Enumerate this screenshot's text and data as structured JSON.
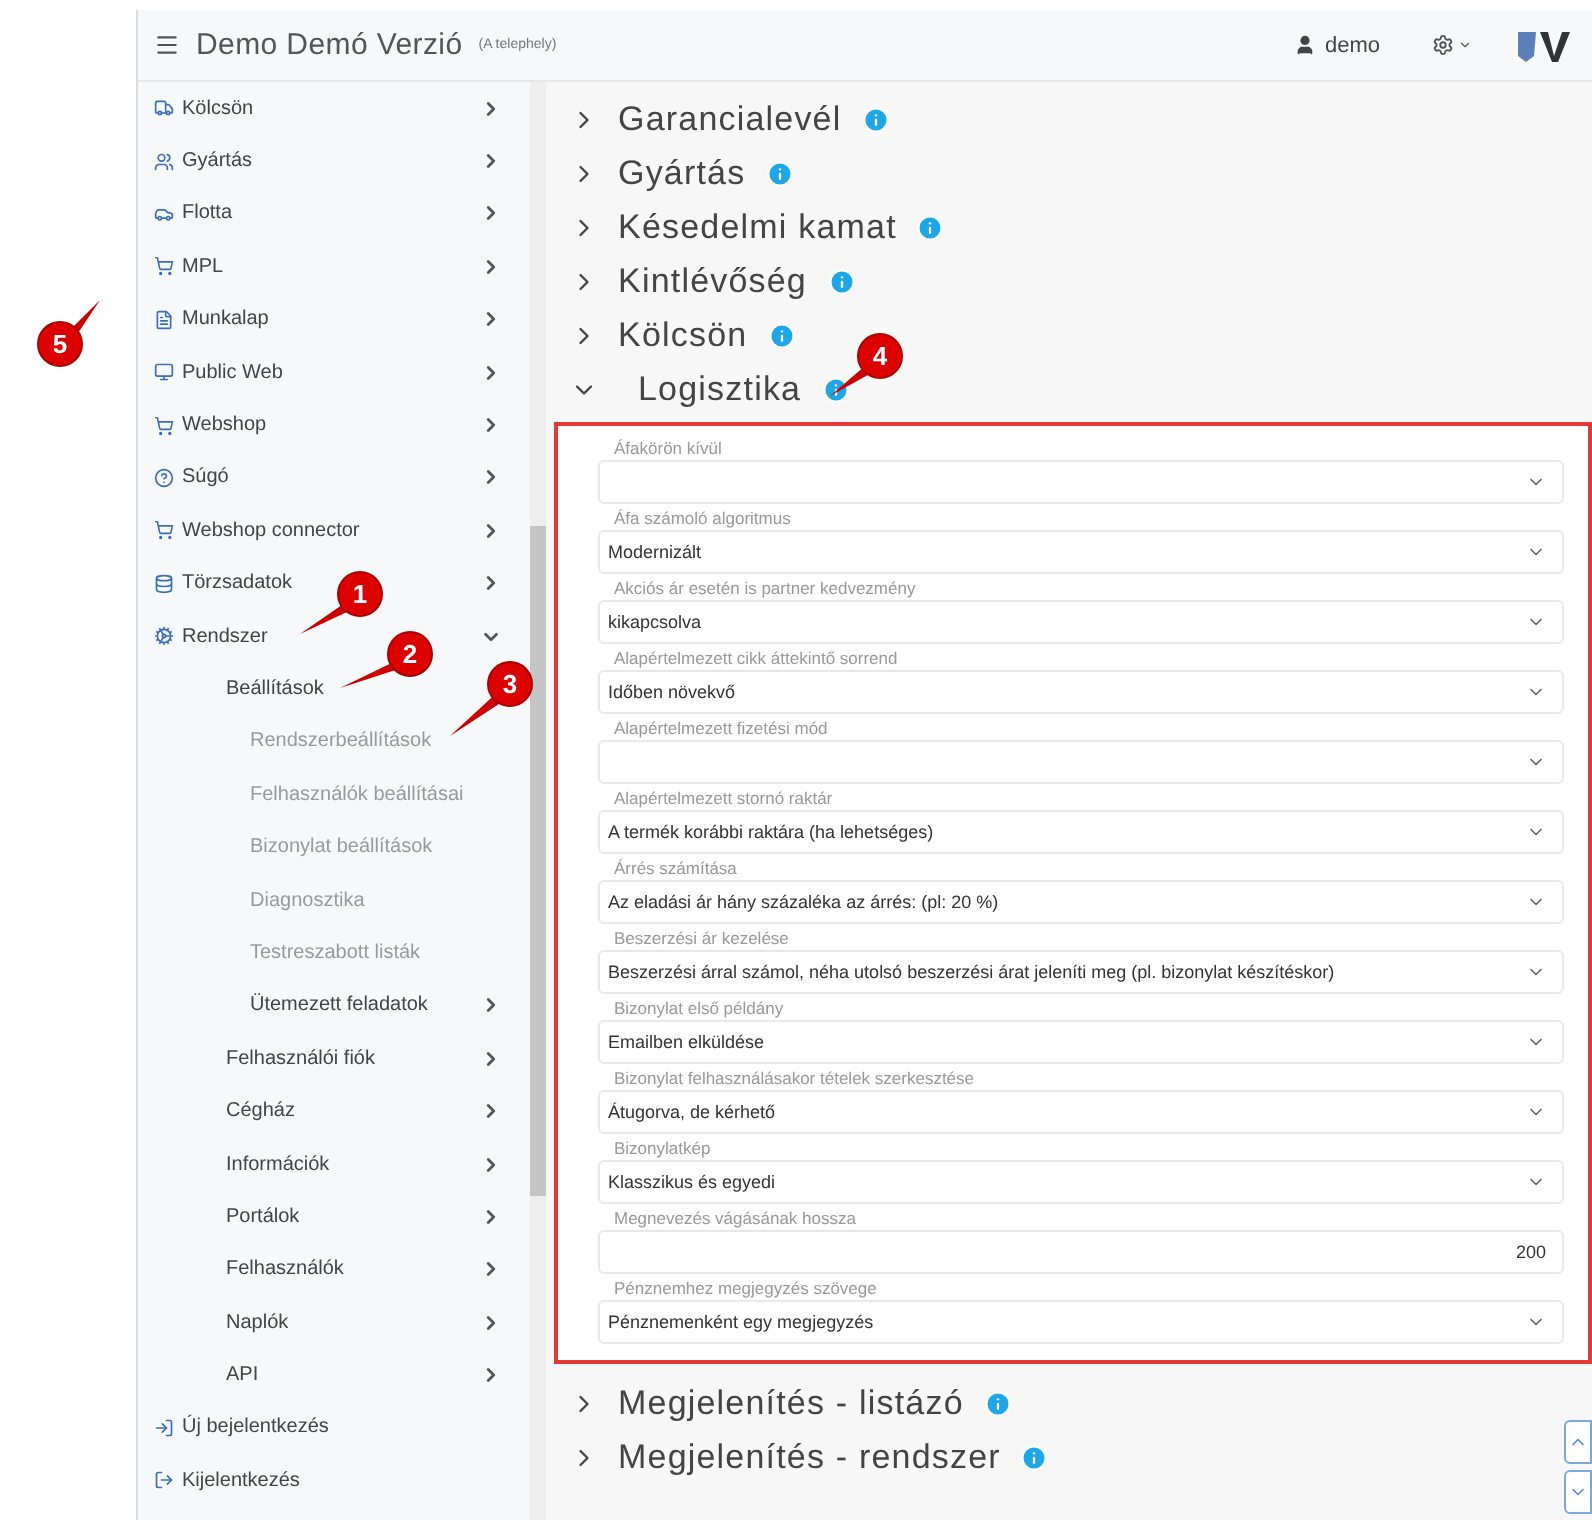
{
  "header": {
    "title": "Demo Demó Verzió",
    "subtitle": "(A telephely)",
    "user": "demo"
  },
  "sidebar": {
    "items": [
      {
        "label": "Kölcsön",
        "kind": "group",
        "expanded": false
      },
      {
        "label": "Gyártás",
        "kind": "group",
        "expanded": false
      },
      {
        "label": "Flotta",
        "kind": "group",
        "expanded": false
      },
      {
        "label": "MPL",
        "kind": "group",
        "expanded": false
      },
      {
        "label": "Munkalap",
        "kind": "group",
        "expanded": false
      },
      {
        "label": "Public Web",
        "kind": "group",
        "expanded": false
      },
      {
        "label": "Webshop",
        "kind": "group",
        "expanded": false
      },
      {
        "label": "Súgó",
        "kind": "group",
        "expanded": false
      },
      {
        "label": "Webshop connector",
        "kind": "group",
        "expanded": false
      },
      {
        "label": "Törzsadatok",
        "kind": "group",
        "expanded": false
      },
      {
        "label": "Rendszer",
        "kind": "group",
        "expanded": true,
        "children": [
          {
            "label": "Beállítások",
            "kind": "link",
            "children": [
              {
                "label": "Rendszerbeállítások",
                "kind": "link"
              },
              {
                "label": "Felhasználók beállításai",
                "kind": "link"
              },
              {
                "label": "Bizonylat beállítások",
                "kind": "link"
              },
              {
                "label": "Diagnosztika",
                "kind": "link"
              },
              {
                "label": "Testreszabott listák",
                "kind": "link"
              },
              {
                "label": "Ütemezett feladatok",
                "kind": "group",
                "expanded": false
              }
            ]
          },
          {
            "label": "Felhasználói fiók",
            "kind": "group",
            "expanded": false
          },
          {
            "label": "Cégház",
            "kind": "group",
            "expanded": false
          },
          {
            "label": "Információk",
            "kind": "group",
            "expanded": false
          },
          {
            "label": "Portálok",
            "kind": "group",
            "expanded": false
          },
          {
            "label": "Felhasználók",
            "kind": "group",
            "expanded": false
          },
          {
            "label": "Naplók",
            "kind": "group",
            "expanded": false
          },
          {
            "label": "API",
            "kind": "group",
            "expanded": false
          }
        ]
      },
      {
        "label": "Új bejelentkezés",
        "kind": "link"
      },
      {
        "label": "Kijelentkezés",
        "kind": "link"
      }
    ]
  },
  "sections": [
    {
      "title": "Garancialevél",
      "expanded": false
    },
    {
      "title": "Gyártás",
      "expanded": false
    },
    {
      "title": "Késedelmi kamat",
      "expanded": false
    },
    {
      "title": "Kintlévőség",
      "expanded": false
    },
    {
      "title": "Kölcsön",
      "expanded": false
    },
    {
      "title": "Logisztika",
      "expanded": true,
      "highlighted": true,
      "fields": [
        {
          "label": "Áfakörön kívül",
          "kind": "select"
        },
        {
          "label": "Áfa számoló algoritmus",
          "kind": "select",
          "value": "Modernizált"
        },
        {
          "label": "Akciós ár esetén is partner kedvezmény",
          "kind": "select",
          "value": "kikapcsolva"
        },
        {
          "label": "Alapértelmezett cikk áttekintő sorrend",
          "kind": "select",
          "value": "Időben növekvő"
        },
        {
          "label": "Alapértelmezett fizetési mód",
          "kind": "select"
        },
        {
          "label": "Alapértelmezett stornó raktár",
          "kind": "select",
          "value": "A termék korábbi raktára (ha lehetséges)"
        },
        {
          "label": "Árrés számítása",
          "kind": "select",
          "value": "Az eladási ár hány százaléka az árrés: (pl: 20 %)"
        },
        {
          "label": "Beszerzési ár kezelése",
          "kind": "select",
          "value": "Beszerzési árral számol, néha utolsó beszerzési árat jeleníti meg (pl. bizonylat készítéskor)"
        },
        {
          "label": "Bizonylat első példány",
          "kind": "select",
          "value": "Emailben elküldése"
        },
        {
          "label": "Bizonylat felhasználásakor tételek szerkesztése",
          "kind": "select",
          "value": "Átugorva, de kérhető"
        },
        {
          "label": "Bizonylatkép",
          "kind": "select",
          "value": "Klasszikus és egyedi"
        },
        {
          "label": "Megnevezés vágásának hossza",
          "kind": "number",
          "value": "200"
        },
        {
          "label": "Pénznemhez megjegyzés szövege",
          "kind": "select",
          "value": "Pénznemenként egy megjegyzés"
        }
      ]
    },
    {
      "title": "Megjelenítés - listázó",
      "expanded": false
    },
    {
      "title": "Megjelenítés - rendszer",
      "expanded": false
    }
  ],
  "callouts": [
    {
      "label": "1"
    },
    {
      "label": "2"
    },
    {
      "label": "3"
    },
    {
      "label": "4"
    },
    {
      "label": "5"
    }
  ]
}
